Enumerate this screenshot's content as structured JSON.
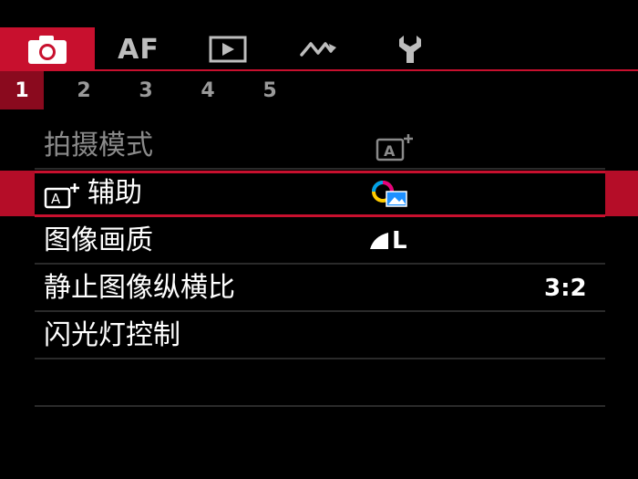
{
  "tabs": [
    {
      "id": "shooting",
      "icon": "camera-icon",
      "active": true
    },
    {
      "id": "af",
      "label": "AF",
      "active": false
    },
    {
      "id": "playback",
      "icon": "playback-icon",
      "active": false
    },
    {
      "id": "wireless",
      "icon": "wireless-icon",
      "active": false
    },
    {
      "id": "setup",
      "icon": "wrench-icon",
      "active": false
    }
  ],
  "subtabs": [
    "1",
    "2",
    "3",
    "4",
    "5"
  ],
  "active_subtab": "1",
  "menu": {
    "items": [
      {
        "label": "拍摄模式",
        "value_icon": "scene-intelligent-auto-icon",
        "dimmed": true
      },
      {
        "label": "辅助",
        "label_icon": "scene-intelligent-auto-icon",
        "value_icon": "creative-assist-icon",
        "selected": true
      },
      {
        "label": "图像画质",
        "value": "L",
        "value_icon": "fine-quality-icon"
      },
      {
        "label": "静止图像纵横比",
        "value": "3:2"
      },
      {
        "label": "闪光灯控制"
      }
    ]
  },
  "colors": {
    "accent": "#c8102e",
    "background": "#000000",
    "dim_text": "#8a8a8a"
  }
}
